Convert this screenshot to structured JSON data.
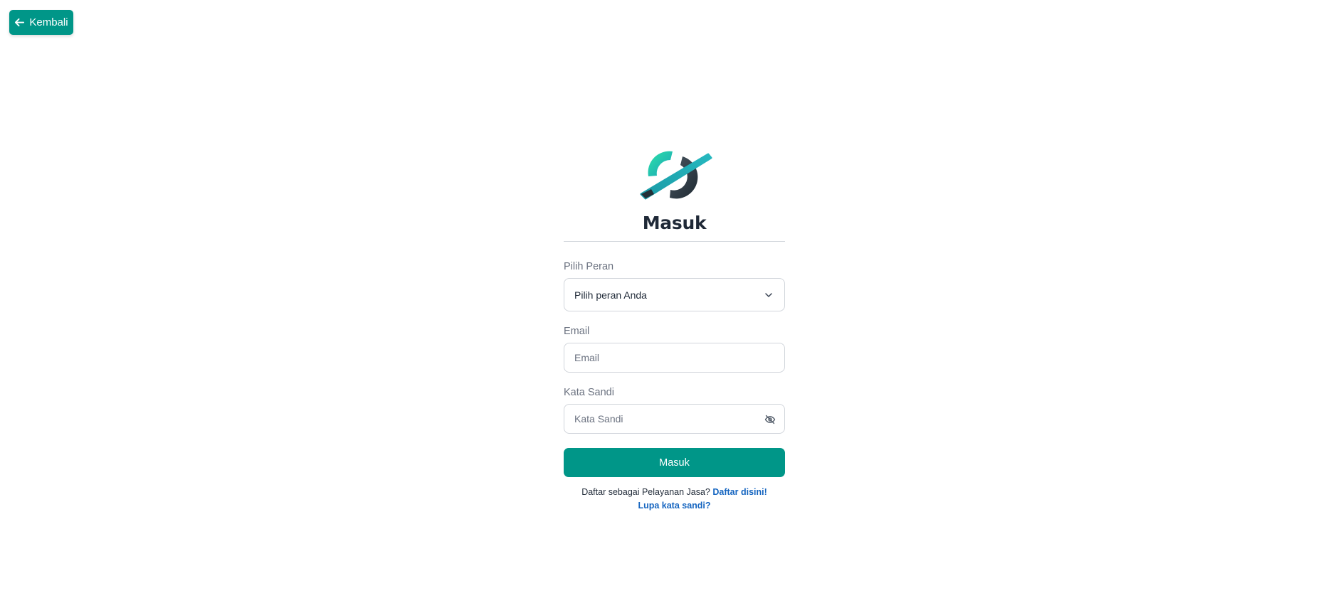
{
  "back_button": {
    "label": "Kembali",
    "icon": "arrow-left-icon"
  },
  "logo": {
    "icon": "brand-logo",
    "colors": {
      "teal_start": "#2de2a8",
      "teal_end": "#1aa3b8",
      "dark": "#2f3b45"
    }
  },
  "title": "Masuk",
  "role": {
    "label": "Pilih Peran",
    "selected": "Pilih peran Anda"
  },
  "email": {
    "label": "Email",
    "placeholder": "Email",
    "value": ""
  },
  "password": {
    "label": "Kata Sandi",
    "placeholder": "Kata Sandi",
    "value": "",
    "toggle_icon": "eye-off-icon"
  },
  "submit_label": "Masuk",
  "footer": {
    "register_prompt": "Daftar sebagai Pelayanan Jasa?",
    "register_link": "Daftar disini!",
    "forgot_link": "Lupa kata sandi?"
  },
  "colors": {
    "accent": "#009688",
    "link": "#1565c0"
  }
}
